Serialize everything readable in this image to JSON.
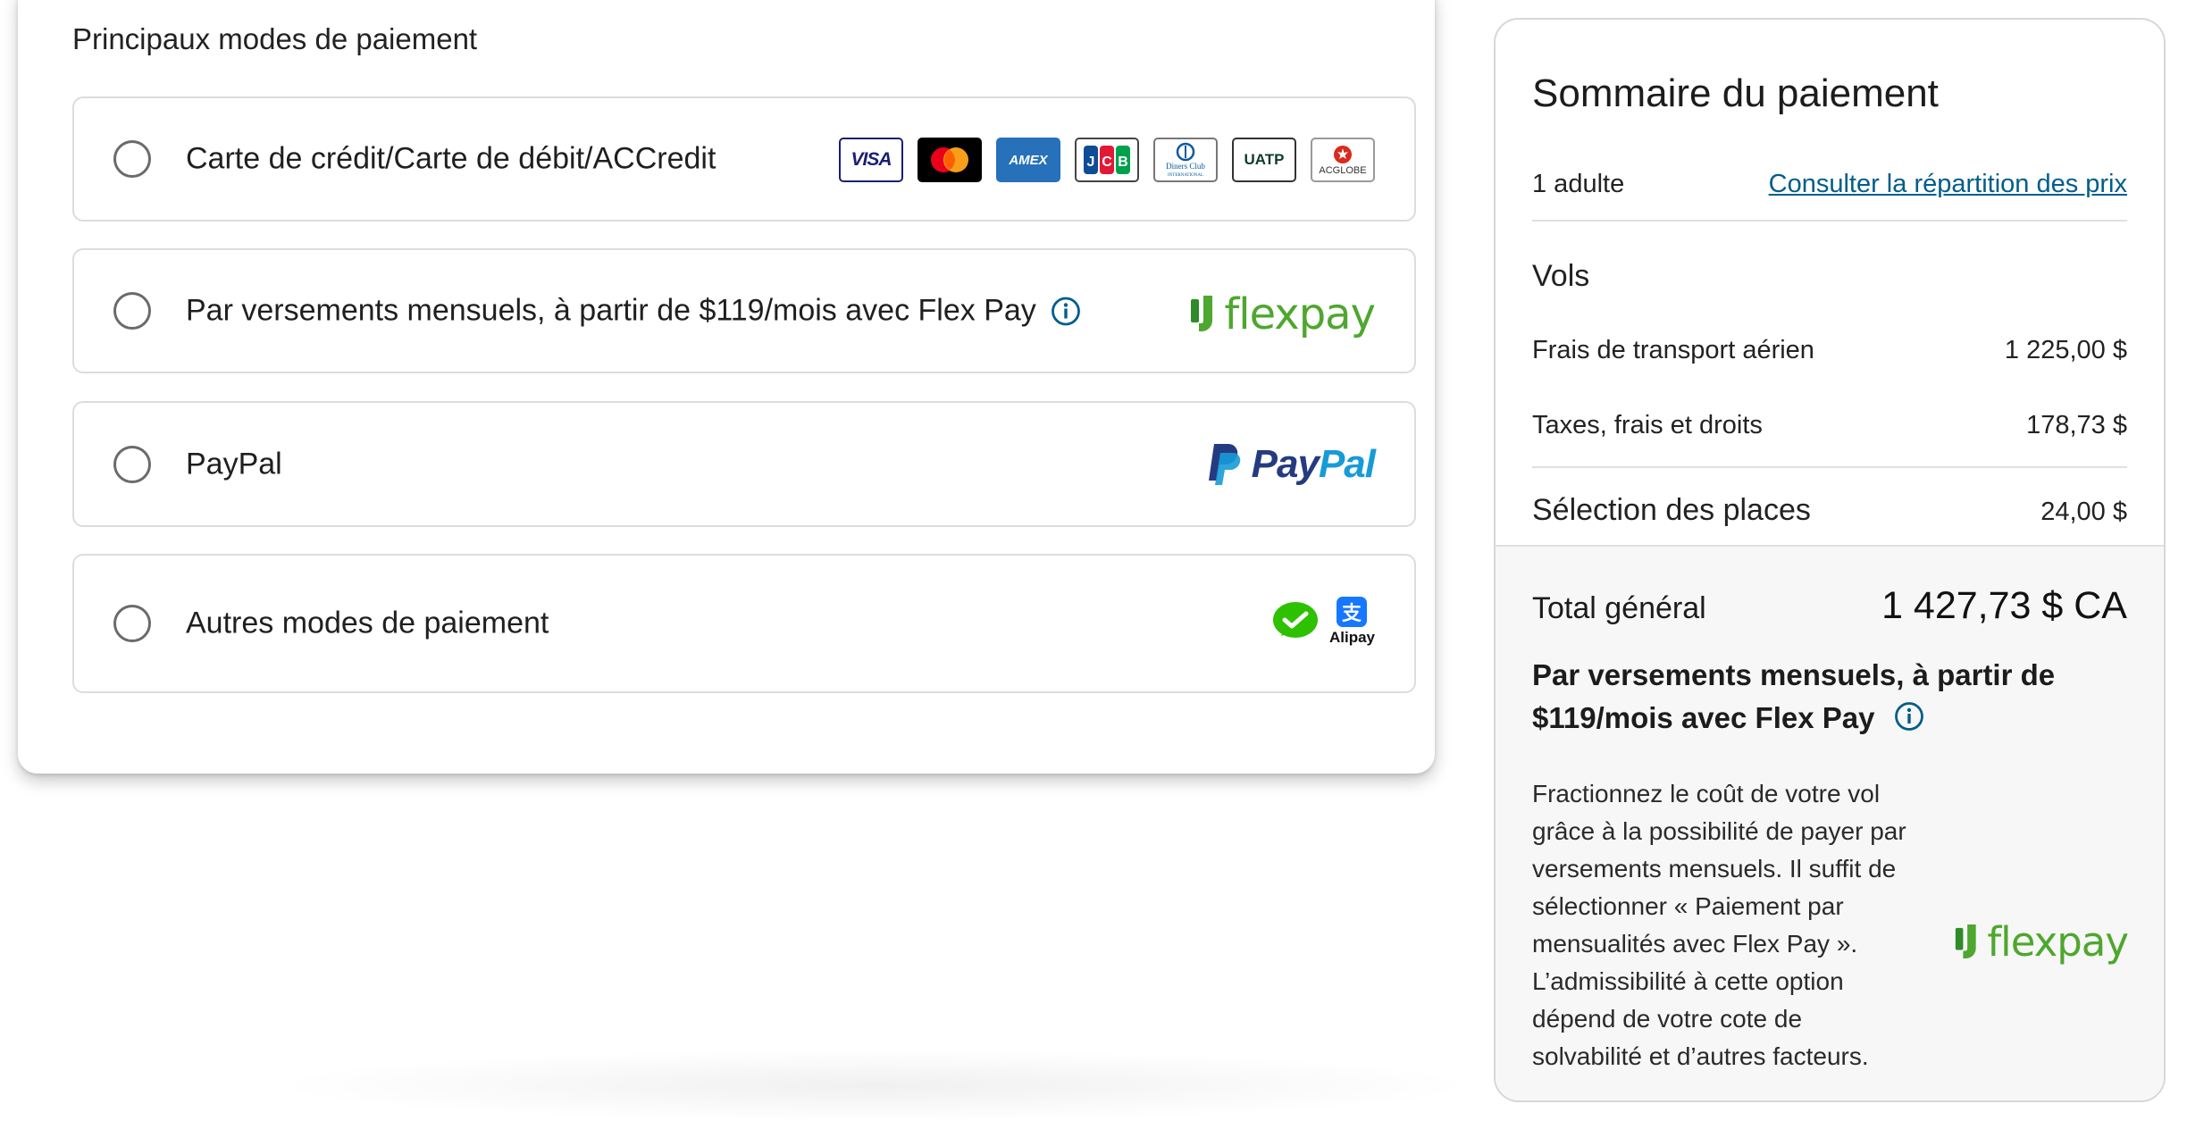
{
  "payment": {
    "heading": "Principaux modes de paiement",
    "options": [
      {
        "label": "Carte de crédit/Carte de débit/ACCredit"
      },
      {
        "label": "Par versements mensuels, à partir de $119/mois avec Flex Pay"
      },
      {
        "label": "PayPal"
      },
      {
        "label": "Autres modes de paiement"
      }
    ],
    "card_logos": {
      "visa": "VISA",
      "amex": "AMEX",
      "diners": "Diners Club",
      "diners_sub": "INTERNATIONAL",
      "uatp": "UATP",
      "acglobe": "ACGLOBE"
    },
    "flexpay_word": "flexpay",
    "paypal_word_1": "Pay",
    "paypal_word_2": "Pal",
    "alipay_label": "Alipay"
  },
  "summary": {
    "title": "Sommaire du paiement",
    "passengers": "1 adulte",
    "price_breakdown_link": "Consulter la répartition des prix",
    "flights_heading": "Vols",
    "fare_label": "Frais de transport aérien",
    "fare_value": "1 225,00 $",
    "taxes_label": "Taxes, frais et droits",
    "taxes_value": "178,73 $",
    "seats_label": "Sélection des places",
    "seats_value": "24,00 $",
    "total_label": "Total général",
    "total_value": "1 427,73 $ CA",
    "flex_heading": "Par versements mensuels, à partir de $119/mois avec Flex Pay",
    "flex_description": "Fractionnez le coût de votre vol grâce à la possibilité de payer par versements mensuels. Il suffit de sélectionner « Paiement par mensualités avec Flex Pay ». L’admissibilité à cette option dépend de votre cote de solvabilité et d’autres facteurs.",
    "flexpay_word": "flexpay"
  },
  "colors": {
    "link": "#005d8c",
    "flexpay_green": "#4ea72e",
    "paypal_dark": "#253b80",
    "paypal_light": "#179bd7"
  }
}
